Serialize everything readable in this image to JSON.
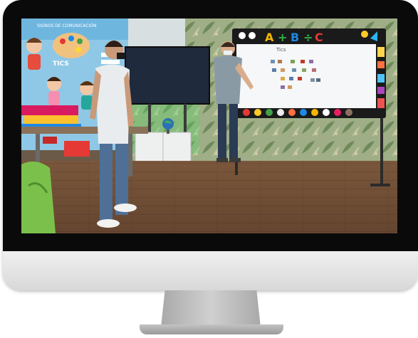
{
  "scene": {
    "board_title": "Tics",
    "poster_text_top": "SIGNOS DE COMUNICACIÓN",
    "poster_text_tics": "TICS",
    "board_letters": [
      "A",
      "+",
      "B",
      "÷",
      "C"
    ]
  }
}
